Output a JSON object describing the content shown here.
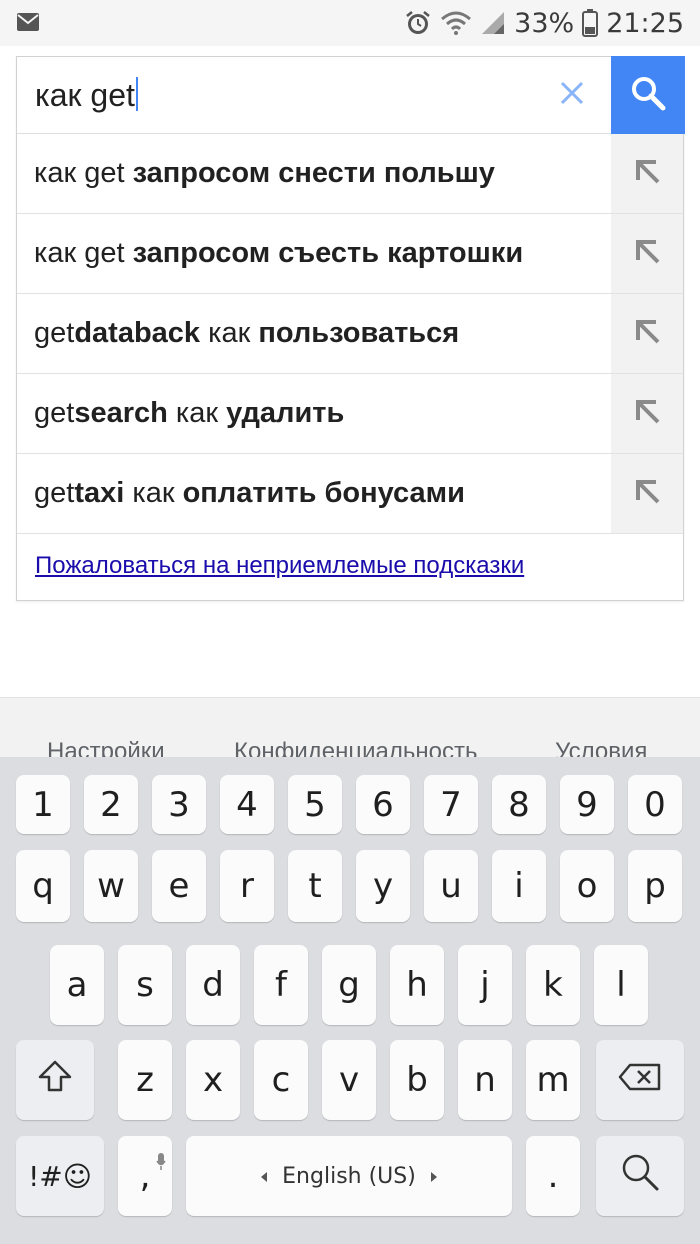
{
  "status_bar": {
    "battery": "33%",
    "time": "21:25",
    "icons": [
      "mail-icon",
      "alarm-icon",
      "wifi-icon",
      "signal-icon",
      "battery-icon"
    ]
  },
  "search": {
    "query": "как get",
    "clear_icon": "close-icon",
    "submit_icon": "search-icon",
    "accent": "#4285f4"
  },
  "suggestions": [
    {
      "parts": [
        {
          "t": "как get ",
          "b": false
        },
        {
          "t": "запросом снести польшу",
          "b": true
        }
      ]
    },
    {
      "parts": [
        {
          "t": "как get ",
          "b": false
        },
        {
          "t": "запросом съесть картошки",
          "b": true
        }
      ]
    },
    {
      "parts": [
        {
          "t": "get",
          "b": false
        },
        {
          "t": "databack",
          "b": true
        },
        {
          "t": " как ",
          "b": false
        },
        {
          "t": "пользоваться",
          "b": true
        }
      ]
    },
    {
      "parts": [
        {
          "t": "get",
          "b": false
        },
        {
          "t": "search",
          "b": true
        },
        {
          "t": " как ",
          "b": false
        },
        {
          "t": "удалить",
          "b": true
        }
      ]
    },
    {
      "parts": [
        {
          "t": "get",
          "b": false
        },
        {
          "t": "taxi",
          "b": true
        },
        {
          "t": " как ",
          "b": false
        },
        {
          "t": "оплатить бонусами",
          "b": true
        }
      ]
    }
  ],
  "report_link": "Пожаловаться на неприемлемые подсказки",
  "footer": {
    "settings": "Настройки",
    "privacy": "Конфиденциальность",
    "terms": "Условия"
  },
  "keyboard": {
    "row_numbers": [
      "1",
      "2",
      "3",
      "4",
      "5",
      "6",
      "7",
      "8",
      "9",
      "0"
    ],
    "row_top": [
      "q",
      "w",
      "e",
      "r",
      "t",
      "y",
      "u",
      "i",
      "o",
      "p"
    ],
    "row_mid": [
      "a",
      "s",
      "d",
      "f",
      "g",
      "h",
      "j",
      "k",
      "l"
    ],
    "row_bottom": [
      "z",
      "x",
      "c",
      "v",
      "b",
      "n",
      "m"
    ],
    "symbols_key": "!#☺",
    "comma_key": ",",
    "space_label": "English (US)",
    "period_key": ".",
    "icons": [
      "shift-icon",
      "backspace-icon",
      "mic-icon",
      "search-icon"
    ]
  }
}
